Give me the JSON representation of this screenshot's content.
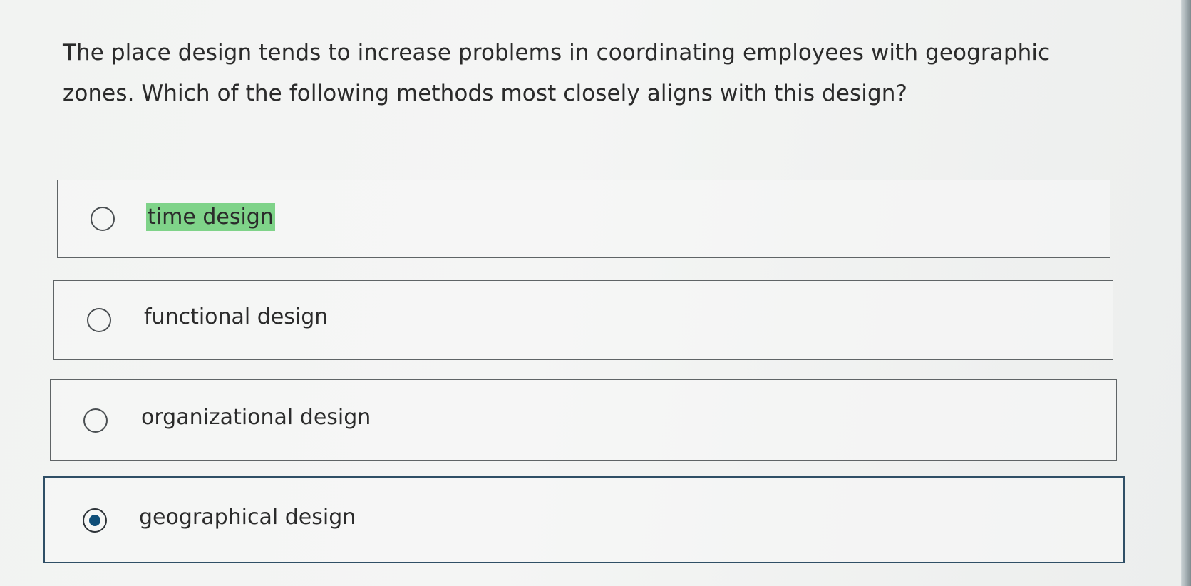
{
  "question": {
    "text": "The place design tends to increase problems in coordinating employees with geographic zones. Which of the following methods most closely aligns with this design?"
  },
  "options": [
    {
      "label": "time design",
      "selected": false,
      "highlighted": true
    },
    {
      "label": "functional design",
      "selected": false,
      "highlighted": false
    },
    {
      "label": "organizational design",
      "selected": false,
      "highlighted": false
    },
    {
      "label": "geographical design",
      "selected": true,
      "highlighted": false
    }
  ],
  "colors": {
    "highlight": "#7fd389",
    "selected_dot": "#0f4e78",
    "selected_border": "#2f4f66"
  }
}
